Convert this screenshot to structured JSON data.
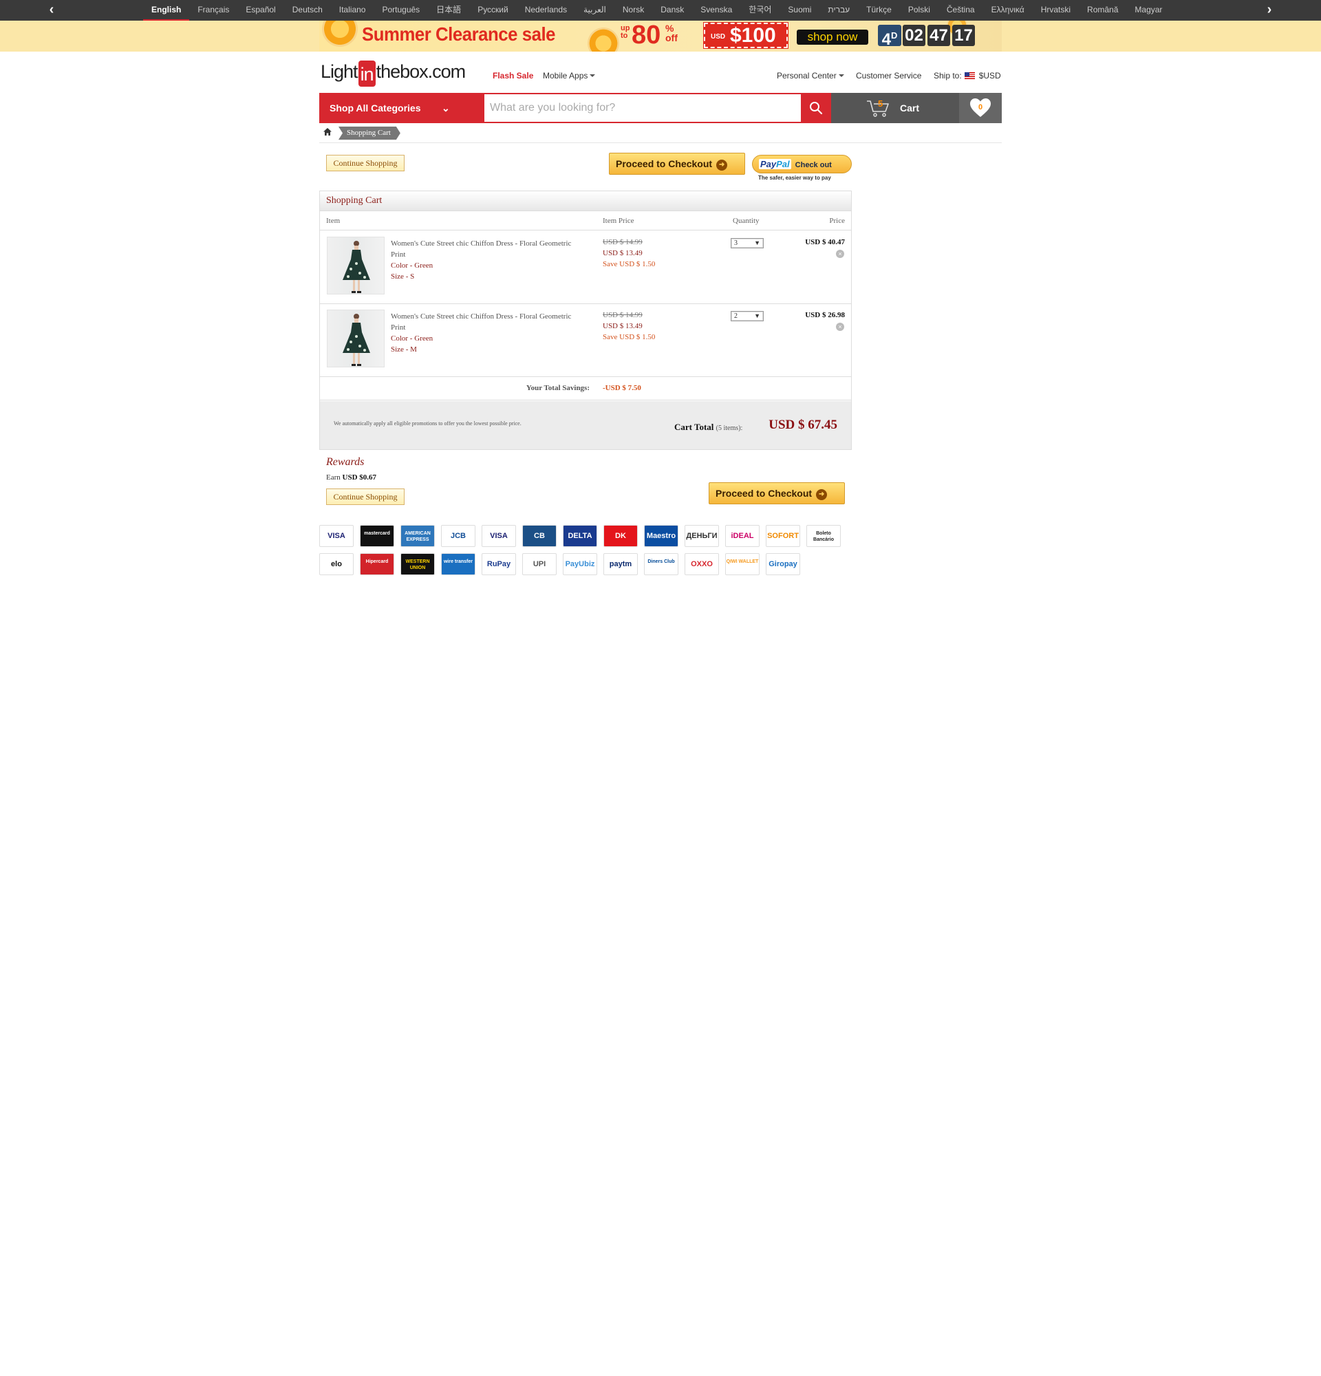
{
  "languages": {
    "items": [
      "English",
      "Français",
      "Español",
      "Deutsch",
      "Italiano",
      "Português",
      "日本語",
      "Русский",
      "Nederlands",
      "العربية",
      "Norsk",
      "Dansk",
      "Svenska",
      "한국어",
      "Suomi",
      "עברית",
      "Türkçe",
      "Polski",
      "Čeština",
      "Ελληνικά",
      "Hrvatski",
      "Română",
      "Magyar"
    ],
    "active": "English",
    "prev_icon": "chevron-left-icon",
    "next_icon": "chevron-right-icon"
  },
  "banner": {
    "title": "Summer Clearance sale",
    "upto": "up to",
    "discount": "80",
    "discount_suffix": "% off",
    "coupon_currency": "USD",
    "coupon_amount": "$100",
    "cta": "shop now",
    "countdown_days": "4",
    "countdown_days_unit": "D",
    "countdown_hours": "02",
    "countdown_minutes": "47",
    "countdown_seconds": "17"
  },
  "header": {
    "logo_pre": "Light",
    "logo_in": "in",
    "logo_post": "thebox.com",
    "flash_sale": "Flash Sale",
    "mobile_apps": "Mobile Apps",
    "personal_center": "Personal Center",
    "customer_service": "Customer Service",
    "ship_to": "Ship to:",
    "currency": "$USD"
  },
  "search": {
    "categories_label": "Shop All Categories",
    "placeholder": "What are you looking for?",
    "cart_label": "Cart",
    "cart_count": "5",
    "wishlist_count": "0"
  },
  "breadcrumb": {
    "current": "Shopping Cart"
  },
  "actions": {
    "continue_shopping": "Continue Shopping",
    "proceed_checkout": "Proceed to Checkout",
    "paypal_brand_1": "Pay",
    "paypal_brand_2": "Pal",
    "paypal_label": "Check out",
    "paypal_note": "The safer, easier way to pay"
  },
  "cart": {
    "title": "Shopping Cart",
    "columns": {
      "item": "Item",
      "item_price": "Item Price",
      "quantity": "Quantity",
      "price": "Price"
    },
    "items": [
      {
        "name": "Women's Cute Street chic Chiffon Dress - Floral Geometric Print",
        "color": "Color - Green",
        "size": "Size - S",
        "original_price": "USD $ 14.99",
        "price": "USD $ 13.49",
        "save": "Save USD $ 1.50",
        "quantity": "3",
        "total": "USD $ 40.47"
      },
      {
        "name": "Women's Cute Street chic Chiffon Dress - Floral Geometric Print",
        "color": "Color - Green",
        "size": "Size - M",
        "original_price": "USD $ 14.99",
        "price": "USD $ 13.49",
        "save": "Save USD $ 1.50",
        "quantity": "2",
        "total": "USD $ 26.98"
      }
    ],
    "savings_label": "Your Total Savings:",
    "savings_value": "-USD $ 7.50",
    "promo_note": "We automatically apply all eligible promotions to offer you the lowest possible price.",
    "total_label": "Cart Total",
    "total_items": "(5 items):",
    "total_value": "USD $ 67.45"
  },
  "rewards": {
    "title": "Rewards",
    "earn_label": "Earn",
    "earn_value": "USD $0.67"
  },
  "payments": {
    "row1": [
      {
        "label": "VISA",
        "bg": "#ffffff",
        "fg": "#1a1f71"
      },
      {
        "label": "mastercard",
        "bg": "#111111",
        "fg": "#ffffff"
      },
      {
        "label": "AMERICAN EXPRESS",
        "bg": "#2e77bb",
        "fg": "#ffffff"
      },
      {
        "label": "JCB",
        "bg": "#ffffff",
        "fg": "#0e4c96"
      },
      {
        "label": "VISA",
        "bg": "#ffffff",
        "fg": "#1a1f71"
      },
      {
        "label": "CB",
        "bg": "#1b4f86",
        "fg": "#ffffff"
      },
      {
        "label": "DELTA",
        "bg": "#1a3b8f",
        "fg": "#ffffff"
      },
      {
        "label": "DK",
        "bg": "#e4141b",
        "fg": "#ffffff"
      },
      {
        "label": "Maestro",
        "bg": "#0b4ea2",
        "fg": "#ffffff"
      },
      {
        "label": "ДЕНЬГИ",
        "bg": "#ffffff",
        "fg": "#333333"
      },
      {
        "label": "iDEAL",
        "bg": "#ffffff",
        "fg": "#cc0066"
      },
      {
        "label": "SOFORT",
        "bg": "#ffffff",
        "fg": "#f08a00"
      },
      {
        "label": "Boleto Bancário",
        "bg": "#ffffff",
        "fg": "#222222"
      }
    ],
    "row2": [
      {
        "label": "elo",
        "bg": "#ffffff",
        "fg": "#111111"
      },
      {
        "label": "Hipercard",
        "bg": "#d2232a",
        "fg": "#ffffff"
      },
      {
        "label": "WESTERN UNION",
        "bg": "#111111",
        "fg": "#ffd400"
      },
      {
        "label": "wire transfer",
        "bg": "#1a6fc0",
        "fg": "#ffffff"
      },
      {
        "label": "RuPay",
        "bg": "#ffffff",
        "fg": "#1d3d8f"
      },
      {
        "label": "UPI",
        "bg": "#ffffff",
        "fg": "#555555"
      },
      {
        "label": "PayUbiz",
        "bg": "#ffffff",
        "fg": "#3a8fd6"
      },
      {
        "label": "paytm",
        "bg": "#ffffff",
        "fg": "#0b2a6e"
      },
      {
        "label": "Diners Club",
        "bg": "#ffffff",
        "fg": "#004a97"
      },
      {
        "label": "OXXO",
        "bg": "#ffffff",
        "fg": "#d7272f"
      },
      {
        "label": "QIWI WALLET",
        "bg": "#ffffff",
        "fg": "#f59a1f"
      },
      {
        "label": "Giropay",
        "bg": "#ffffff",
        "fg": "#1a6fc0"
      }
    ]
  },
  "colors": {
    "brand_red": "#d7272f",
    "price_red": "#8b0f12",
    "save_orange": "#d4531e"
  }
}
